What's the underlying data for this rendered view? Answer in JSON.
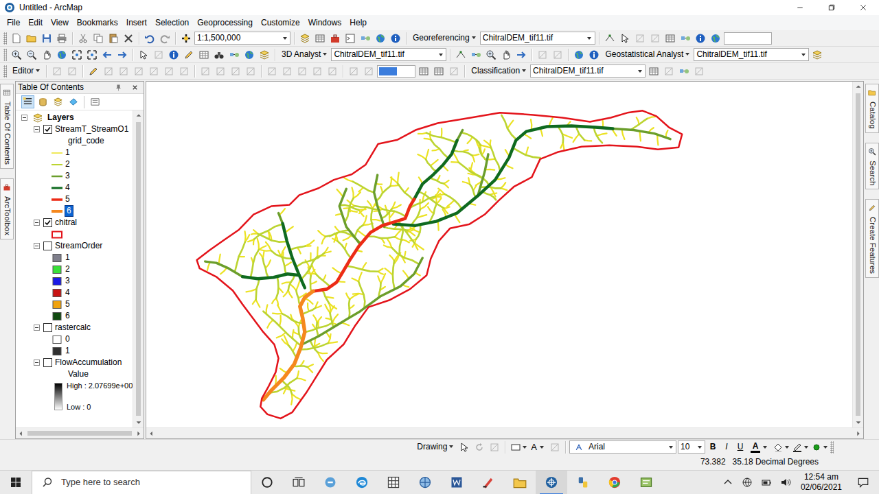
{
  "window": {
    "title": "Untitled - ArcMap"
  },
  "menu": [
    "File",
    "Edit",
    "View",
    "Bookmarks",
    "Insert",
    "Selection",
    "Geoprocessing",
    "Customize",
    "Windows",
    "Help"
  ],
  "toolbars": [
    {
      "controls": [
        {
          "kind": "combo",
          "text": "1:1,500,000"
        },
        {
          "kind": "menu",
          "text": "Georeferencing"
        },
        {
          "kind": "combo",
          "text": "ChitralDEM_tif11.tif"
        },
        {
          "kind": "field"
        }
      ]
    },
    {
      "controls": [
        {
          "kind": "menu",
          "text": "3D Analyst"
        },
        {
          "kind": "combo",
          "text": "ChitralDEM_tif11.tif"
        },
        {
          "kind": "menu",
          "text": "Geostatistical Analyst"
        },
        {
          "kind": "combo",
          "text": "ChitralDEM_tif11.tif"
        }
      ]
    },
    {
      "controls": [
        {
          "kind": "menu",
          "text": "Editor"
        },
        {
          "kind": "highlight"
        },
        {
          "kind": "menu",
          "text": "Classification"
        },
        {
          "kind": "combo",
          "text": "ChitralDEM_tif11.tif"
        }
      ]
    }
  ],
  "side_tabs": {
    "left": [
      "Table Of Contents",
      "ArcToolbox"
    ],
    "right": [
      "Catalog",
      "Search",
      "Create Features"
    ]
  },
  "toc": {
    "title": "Table Of Contents",
    "views": [
      {
        "selected": true
      },
      {
        "selected": false
      },
      {
        "selected": false
      },
      {
        "selected": false
      },
      {
        "selected": false
      }
    ],
    "root": {
      "label": "Layers",
      "expanded": true
    },
    "layers": [
      {
        "name": "StreamT_StreamO1",
        "checked": true,
        "expanded": true,
        "field": "grid_code",
        "classes": [
          {
            "label": "1",
            "kind": "line",
            "color": "#ebe224",
            "selected": false
          },
          {
            "label": "2",
            "kind": "line",
            "color": "#bcd431",
            "selected": false
          },
          {
            "label": "3",
            "kind": "line",
            "color": "#6b9e2c",
            "selected": false
          },
          {
            "label": "4",
            "kind": "line",
            "color": "#0f6a1f",
            "selected": false
          },
          {
            "label": "5",
            "kind": "line",
            "color": "#ec2b16",
            "selected": false
          },
          {
            "label": "6",
            "kind": "line",
            "color": "#f5881e",
            "selected": true
          }
        ]
      },
      {
        "name": "chitral",
        "checked": true,
        "expanded": true,
        "classes": [
          {
            "kind": "outline",
            "color": "#e3141b"
          }
        ]
      },
      {
        "name": "StreamOrder",
        "checked": false,
        "expanded": true,
        "classes": [
          {
            "label": "1",
            "kind": "fill",
            "color": "#7f7f8c"
          },
          {
            "label": "2",
            "kind": "fill",
            "color": "#39e039"
          },
          {
            "label": "3",
            "kind": "fill",
            "color": "#1a1ae6"
          },
          {
            "label": "4",
            "kind": "fill",
            "color": "#c81414"
          },
          {
            "label": "5",
            "kind": "fill",
            "color": "#f0a30f"
          },
          {
            "label": "6",
            "kind": "fill",
            "color": "#104a10"
          }
        ]
      },
      {
        "name": "rastercalc",
        "checked": false,
        "expanded": true,
        "classes": [
          {
            "label": "0",
            "kind": "fill",
            "color": "#ffffff"
          },
          {
            "label": "1",
            "kind": "fill",
            "color": "#303030"
          }
        ]
      },
      {
        "name": "FlowAccumulation",
        "checked": false,
        "expanded": true,
        "field": "Value",
        "ramp": {
          "high": "High : 2.07699e+00",
          "low": "Low : 0"
        }
      }
    ]
  },
  "drawing_toolbar": {
    "menu": "Drawing",
    "text_tool": "A",
    "font": "Arial",
    "size": "10",
    "styles": [
      "B",
      "I",
      "U"
    ],
    "font_color": "A"
  },
  "status_bar": {
    "x": "73.382",
    "y": "35.18 Decimal Degrees"
  },
  "taskbar": {
    "search": "Type here to search",
    "apps": [
      {
        "selected": false
      },
      {
        "selected": false
      },
      {
        "selected": false
      },
      {
        "selected": false
      },
      {
        "selected": false
      },
      {
        "selected": false
      },
      {
        "selected": false
      },
      {
        "selected": true
      },
      {
        "selected": false
      },
      {
        "selected": false
      },
      {
        "selected": false
      }
    ],
    "time": "12:54 am",
    "date": "02/06/2021"
  }
}
